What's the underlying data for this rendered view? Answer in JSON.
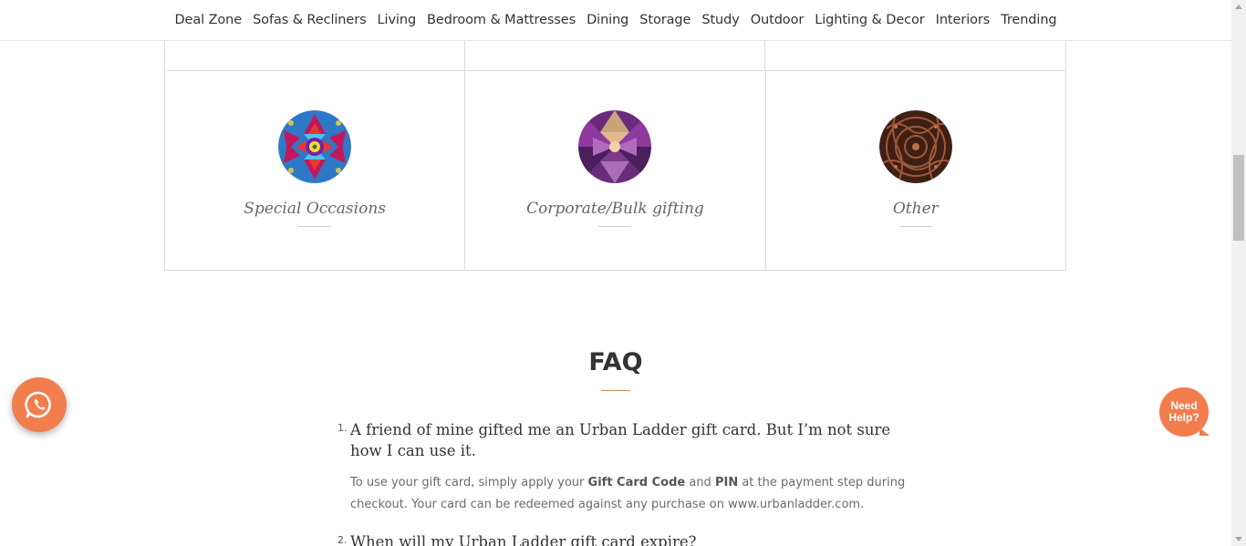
{
  "nav": {
    "items": [
      "Deal Zone",
      "Sofas & Recliners",
      "Living",
      "Bedroom & Mattresses",
      "Dining",
      "Storage",
      "Study",
      "Outdoor",
      "Lighting & Decor",
      "Interiors",
      "Trending"
    ]
  },
  "occasions": [
    {
      "label": "Special Occasions",
      "icon": "kaleidoscope-blue-icon"
    },
    {
      "label": "Corporate/Bulk gifting",
      "icon": "kaleidoscope-purple-icon"
    },
    {
      "label": "Other",
      "icon": "paisley-brown-icon"
    }
  ],
  "faq": {
    "title": "FAQ",
    "items": [
      {
        "num": "1.",
        "question": "A friend of mine gifted me an Urban Ladder gift card. But I’m not sure how I can use it.",
        "answer_parts": [
          "To use your gift card, simply apply your ",
          "Gift Card Code",
          " and ",
          "PIN",
          " at the payment step during checkout. Your card can be redeemed against any purchase on www.urbanladder.com."
        ]
      },
      {
        "num": "2.",
        "question": "When will my Urban Ladder gift card expire?"
      }
    ]
  },
  "help": {
    "label_line1": "Need",
    "label_line2": "Help?"
  },
  "colors": {
    "accent": "#f27d4d",
    "rule": "#c98a57"
  }
}
